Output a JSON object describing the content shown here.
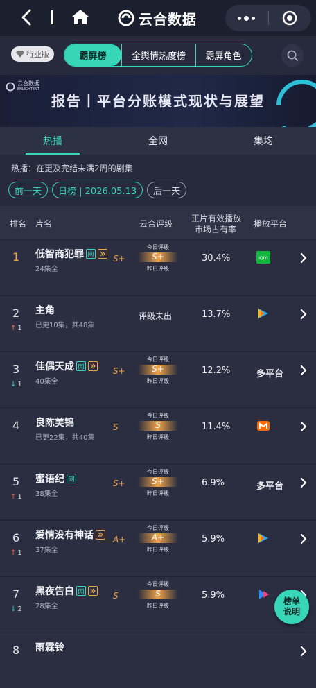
{
  "app": {
    "title": "云合数据"
  },
  "industry_badge": "行业版",
  "main_tabs": [
    {
      "label": "霸屏榜",
      "active": true
    },
    {
      "label": "全舆情热度榜",
      "active": false
    },
    {
      "label": "霸屏角色",
      "active": false
    }
  ],
  "banner": {
    "brand": "云合数据",
    "brand_en": "ENLIGHTENT",
    "title": "报告丨平台分账模式现状与展望"
  },
  "sub_tabs": [
    {
      "label": "热播",
      "active": true
    },
    {
      "label": "全网",
      "active": false
    },
    {
      "label": "集均",
      "active": false
    }
  ],
  "description": "热播：在更及完结未满2周的剧集",
  "date_nav": {
    "prev": "前一天",
    "current": "日榜 | 2026.05.13",
    "next": "后一天"
  },
  "table": {
    "headers": {
      "rank": "排名",
      "name": "片名",
      "rating": "云合评级",
      "share_l1": "正片有效播放",
      "share_l2": "市场占有率",
      "platform": "播放平台"
    },
    "rating_today": "今日评级",
    "rating_yesterday": "昨日评级",
    "rows": [
      {
        "rank": "1",
        "change": "",
        "dir": "",
        "name": "低智商犯罪",
        "wang": true,
        "vip": true,
        "sub": "24集全",
        "grade": "S+",
        "grade_box": "S+",
        "rating_text": "",
        "share": "30.4%",
        "platform": "iqiyi",
        "platform_text": ""
      },
      {
        "rank": "2",
        "change": "1",
        "dir": "up",
        "name": "主角",
        "wang": false,
        "vip": false,
        "sub": "已更10集，共48集",
        "grade": "",
        "grade_box": "",
        "rating_text": "评级未出",
        "share": "13.7%",
        "platform": "tencent",
        "platform_text": ""
      },
      {
        "rank": "3",
        "change": "1",
        "dir": "down",
        "name": "佳偶天成",
        "wang": true,
        "vip": true,
        "sub": "40集全",
        "grade": "S+",
        "grade_box": "S+",
        "rating_text": "",
        "share": "12.2%",
        "platform": "",
        "platform_text": "多平台"
      },
      {
        "rank": "4",
        "change": "",
        "dir": "",
        "name": "良陈美锦",
        "wang": false,
        "vip": false,
        "sub": "已更22集，共40集",
        "grade": "S",
        "grade_box": "S",
        "rating_text": "",
        "share": "11.4%",
        "platform": "mango",
        "platform_text": ""
      },
      {
        "rank": "5",
        "change": "1",
        "dir": "up",
        "name": "蜜语纪",
        "wang": true,
        "vip": false,
        "sub": "38集全",
        "grade": "S+",
        "grade_box": "S+",
        "rating_text": "",
        "share": "6.9%",
        "platform": "",
        "platform_text": "多平台"
      },
      {
        "rank": "6",
        "change": "1",
        "dir": "up",
        "name": "爱情没有神话",
        "wang": false,
        "vip": true,
        "sub": "37集全",
        "grade": "A+",
        "grade_box": "A+",
        "rating_text": "",
        "share": "5.9%",
        "platform": "tencent",
        "platform_text": ""
      },
      {
        "rank": "7",
        "change": "2",
        "dir": "down",
        "name": "黑夜告白",
        "wang": true,
        "vip": true,
        "sub": "28集全",
        "grade": "S",
        "grade_box": "S",
        "rating_text": "",
        "share": "5.9%",
        "platform": "youku",
        "platform_text": ""
      },
      {
        "rank": "8",
        "change": "",
        "dir": "",
        "name": "雨霖铃",
        "wang": false,
        "vip": false,
        "sub": "",
        "grade": "",
        "grade_box": "",
        "rating_text": "",
        "share": "",
        "platform": "",
        "platform_text": ""
      }
    ]
  },
  "float_button": {
    "line1": "榜单",
    "line2": "说明"
  },
  "colors": {
    "accent": "#37d6b8",
    "gold": "#f0a245",
    "up": "#ff6a4a",
    "bg": "#262a3c"
  }
}
